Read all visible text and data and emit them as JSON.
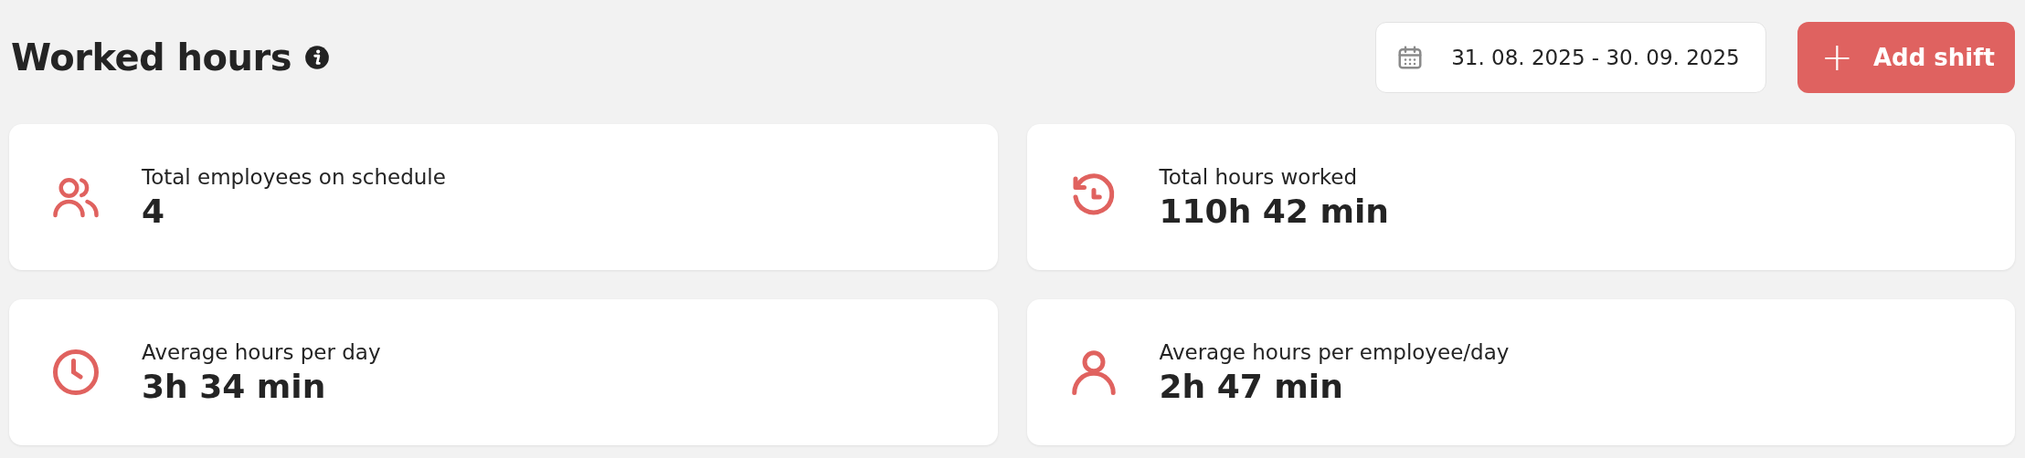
{
  "header": {
    "title": "Worked hours",
    "date_range": "31. 08. 2025 - 30. 09. 2025",
    "add_button": {
      "icon": "+",
      "label": "Add shift"
    }
  },
  "stats": [
    {
      "kind": "people",
      "label": "Total employees on schedule",
      "value": "4"
    },
    {
      "kind": "history",
      "label": "Total hours worked",
      "value": "110h 42 min"
    },
    {
      "kind": "clock",
      "label": "Average hours per day",
      "value": "3h 34 min"
    },
    {
      "kind": "person",
      "label": "Average hours per employee/day",
      "value": "2h 47 min"
    }
  ]
}
